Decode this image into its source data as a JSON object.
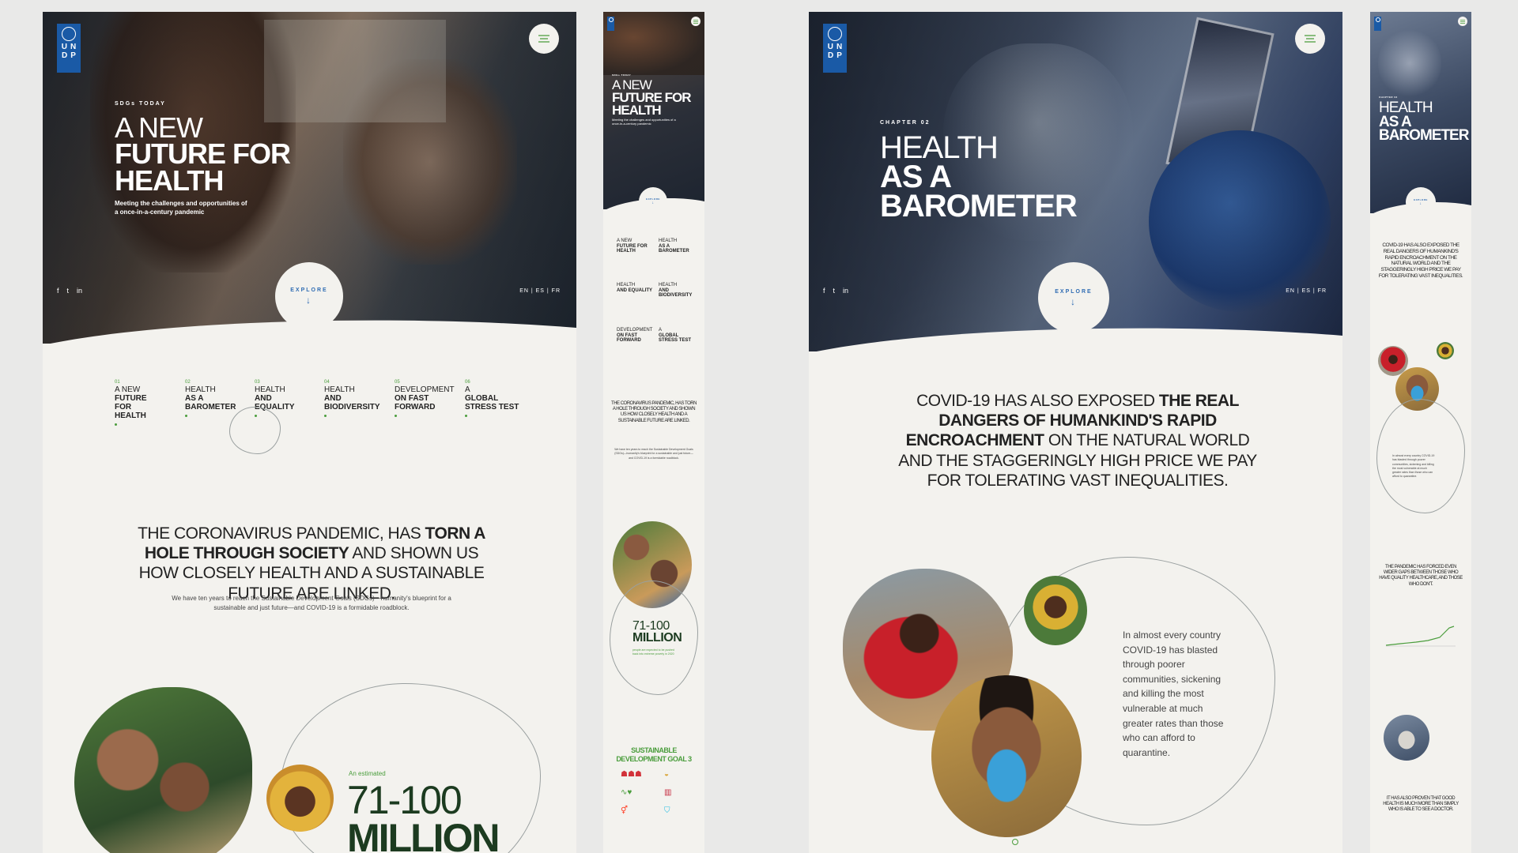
{
  "colors": {
    "accent_green": "#4a9d3c",
    "undp_blue": "#1a5aa6",
    "page_bg": "#f3f2ee",
    "backdrop": "#e9e9e8"
  },
  "logo": {
    "letters": [
      "U",
      "N",
      "D",
      "P"
    ]
  },
  "social": [
    "f",
    "t",
    "in"
  ],
  "languages": "EN | ES | FR",
  "explore_label": "EXPLORE",
  "page1": {
    "kicker": "SDGs TODAY",
    "title_light": "A NEW",
    "title_bold_1": "FUTURE FOR",
    "title_bold_2": "HEALTH",
    "subtitle": "Meeting the challenges and opportunities of a once-in-a-century pandemic",
    "nav": [
      {
        "num": "01",
        "light": "A NEW",
        "bold": "FUTURE FOR HEALTH"
      },
      {
        "num": "02",
        "light": "HEALTH",
        "bold": "AS A BAROMETER"
      },
      {
        "num": "03",
        "light": "HEALTH",
        "bold": "AND EQUALITY"
      },
      {
        "num": "04",
        "light": "HEALTH",
        "bold": "AND BIODIVERSITY"
      },
      {
        "num": "05",
        "light": "DEVELOPMENT",
        "bold": "ON FAST FORWARD"
      },
      {
        "num": "06",
        "light": "A",
        "bold": "GLOBAL STRESS TEST"
      }
    ],
    "lead_part1": "THE CORONAVIRUS PANDEMIC, HAS ",
    "lead_bold": "TORN A HOLE THROUGH SOCIETY",
    "lead_part2": " AND SHOWN US HOW CLOSELY HEALTH AND A SUSTAINABLE FUTURE ARE LINKED.",
    "body": "We have ten years to reach the Sustainable Development Goals (SDGs)—humanity's blueprint for a sustainable and just future—and COVID-19 is a formidable roadblock.",
    "estimated_label": "An estimated",
    "stat_line1": "71-100",
    "stat_line2": "MILLION"
  },
  "page2": {
    "kicker": "CHAPTER 02",
    "title_light": "HEALTH",
    "title_bold_1": "AS A",
    "title_bold_2": "BAROMETER",
    "lead_part1": "COVID-19 HAS ALSO EXPOSED ",
    "lead_bold": "THE REAL DANGERS OF HUMANKIND'S RAPID ENCROACHMENT",
    "lead_part2": " ON THE NATURAL WORLD AND THE STAGGERINGLY HIGH PRICE WE PAY FOR TOLERATING VAST INEQUALITIES.",
    "body": "In almost every country COVID-19 has blasted through poorer communities, sickening and killing the most vulnerable at much greater rates than those who can afford to quarantine."
  },
  "mobile1": {
    "kicker": "SDGs TODAY",
    "title_light": "A NEW",
    "title_bold": "FUTURE FOR HEALTH",
    "subtitle": "Meeting the challenges and opportunities of a once-in-a-century pandemic",
    "nav": [
      {
        "light": "A NEW",
        "bold": "FUTURE FOR HEALTH"
      },
      {
        "light": "HEALTH",
        "bold": "AS A BAROMETER"
      },
      {
        "light": "HEALTH",
        "bold": "AND EQUALITY"
      },
      {
        "light": "HEALTH",
        "bold": "AND BIODIVERSITY"
      },
      {
        "light": "DEVELOPMENT",
        "bold": "ON FAST FORWARD"
      },
      {
        "light": "A",
        "bold": "GLOBAL STRESS TEST"
      }
    ],
    "lead": "THE CORONAVIRUS PANDEMIC, HAS TORN A HOLE THROUGH SOCIETY AND SHOWN US HOW CLOSELY HEALTH AND A SUSTAINABLE FUTURE ARE LINKED.",
    "body": "We have ten years to reach the Sustainable Development Goals (SDGs)—humanity's blueprint for a sustainable and just future—and COVID-19 is a formidable roadblock.",
    "stat_line1": "71-100",
    "stat_line2": "MILLION",
    "stat_caption": "people are expected to be pushed back into extreme poverty in 2020",
    "goal_title": "SUSTAINABLE DEVELOPMENT GOAL 3"
  },
  "mobile2": {
    "kicker": "CHAPTER 02",
    "title_light": "HEALTH",
    "title_bold": "AS A BAROMETER",
    "lead": "COVID-19 HAS ALSO EXPOSED THE REAL DANGERS OF HUMANKIND'S RAPID ENCROACHMENT ON THE NATURAL WORLD AND THE STAGGERINGLY HIGH PRICE WE PAY FOR TOLERATING VAST INEQUALITIES.",
    "small1": "In almost every country COVID-19 has blasted through poorer communities, sickening and killing the most vulnerable at much greater rates than those who can afford to quarantine.",
    "lead2": "THE PANDEMIC HAS FORCED EVEN WIDER GAPS BETWEEN THOSE WHO HAVE QUALITY HEALTHCARE, AND THOSE WHO DON'T.",
    "lead3": "IT HAS ALSO PROVEN THAT GOOD HEALTH IS MUCH MORE THAN SIMPLY WHO IS ABLE TO SEE A DOCTOR."
  }
}
